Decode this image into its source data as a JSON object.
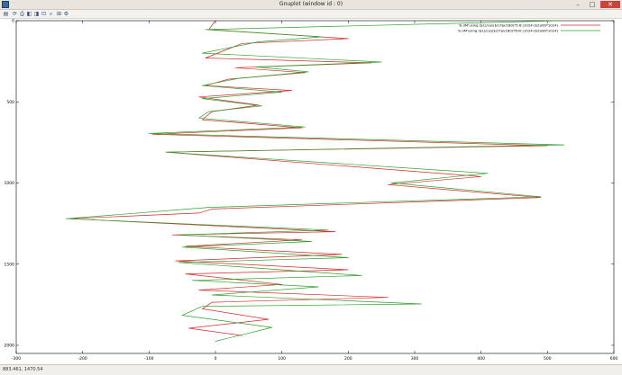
{
  "window": {
    "title": "Gnuplot (window id : 0)"
  },
  "titlebar_buttons": {
    "minimize": "–",
    "maximize": "□",
    "close": "✕"
  },
  "toolbar": [
    {
      "name": "copy-icon",
      "glyph": "▤"
    },
    {
      "name": "replot-icon",
      "glyph": "⟳"
    },
    {
      "name": "print-icon",
      "glyph": "⎙"
    },
    {
      "name": "zoom-previous-icon",
      "glyph": "◧"
    },
    {
      "name": "zoom-next-icon",
      "glyph": "◨"
    },
    {
      "name": "unzoom-icon",
      "glyph": "⊡"
    },
    {
      "name": "zoom-icon",
      "glyph": "⌕"
    },
    {
      "name": "grid-icon",
      "glyph": "⊞"
    },
    {
      "name": "settings-icon",
      "glyph": "⚙"
    }
  ],
  "status": {
    "coords": "883.461, 1470.54"
  },
  "chart_data": {
    "type": "line",
    "title": "",
    "xlabel": "",
    "ylabel": "",
    "xlim": [
      -300,
      600
    ],
    "ylim": [
      2050,
      0
    ],
    "x_ticks": [
      -300,
      -200,
      -100,
      0,
      100,
      200,
      300,
      400,
      500,
      600
    ],
    "y_ticks": [
      0,
      500,
      1000,
      1500,
      2000
    ],
    "legend_position": "top-right",
    "grid": false,
    "series": [
      {
        "name": "'b-3M'using ($1)/cos($2)*pi/180)*5.6:(1024-($2)/90*1024)",
        "color": "#d62728",
        "points": [
          [
            0,
            0
          ],
          [
            -10,
            55
          ],
          [
            200,
            110
          ],
          [
            40,
            140
          ],
          [
            -15,
            230
          ],
          [
            235,
            260
          ],
          [
            30,
            290
          ],
          [
            135,
            320
          ],
          [
            20,
            360
          ],
          [
            -15,
            400
          ],
          [
            115,
            430
          ],
          [
            -25,
            470
          ],
          [
            65,
            520
          ],
          [
            -5,
            560
          ],
          [
            -20,
            610
          ],
          [
            130,
            660
          ],
          [
            -95,
            700
          ],
          [
            500,
            770
          ],
          [
            -75,
            810
          ],
          [
            400,
            960
          ],
          [
            260,
            1010
          ],
          [
            490,
            1090
          ],
          [
            -5,
            1160
          ],
          [
            -25,
            1185
          ],
          [
            -220,
            1220
          ],
          [
            180,
            1300
          ],
          [
            -65,
            1320
          ],
          [
            130,
            1350
          ],
          [
            -45,
            1390
          ],
          [
            190,
            1440
          ],
          [
            -60,
            1480
          ],
          [
            200,
            1535
          ],
          [
            -45,
            1560
          ],
          [
            100,
            1625
          ],
          [
            -25,
            1660
          ],
          [
            260,
            1705
          ],
          [
            -5,
            1735
          ],
          [
            -20,
            1775
          ],
          [
            80,
            1840
          ],
          [
            -40,
            1895
          ],
          [
            40,
            1940
          ]
        ]
      },
      {
        "name": "'b-3M'using ($1)/cos($2)*pi/180)*500:(1024-($2)/90*1024)",
        "color": "#2ca02c",
        "points": [
          [
            520,
            0
          ],
          [
            -15,
            55
          ],
          [
            160,
            100
          ],
          [
            65,
            130
          ],
          [
            -20,
            200
          ],
          [
            250,
            255
          ],
          [
            60,
            285
          ],
          [
            140,
            315
          ],
          [
            35,
            355
          ],
          [
            -20,
            400
          ],
          [
            100,
            440
          ],
          [
            -20,
            480
          ],
          [
            70,
            525
          ],
          [
            -10,
            560
          ],
          [
            -25,
            600
          ],
          [
            135,
            655
          ],
          [
            -100,
            695
          ],
          [
            525,
            765
          ],
          [
            -75,
            810
          ],
          [
            410,
            940
          ],
          [
            265,
            1000
          ],
          [
            490,
            1085
          ],
          [
            -10,
            1150
          ],
          [
            -225,
            1220
          ],
          [
            170,
            1290
          ],
          [
            -55,
            1320
          ],
          [
            145,
            1360
          ],
          [
            -50,
            1395
          ],
          [
            200,
            1460
          ],
          [
            -55,
            1490
          ],
          [
            220,
            1570
          ],
          [
            -35,
            1600
          ],
          [
            155,
            1640
          ],
          [
            -5,
            1690
          ],
          [
            310,
            1745
          ],
          [
            -20,
            1760
          ],
          [
            -50,
            1815
          ],
          [
            85,
            1890
          ],
          [
            0,
            1975
          ]
        ]
      }
    ]
  }
}
